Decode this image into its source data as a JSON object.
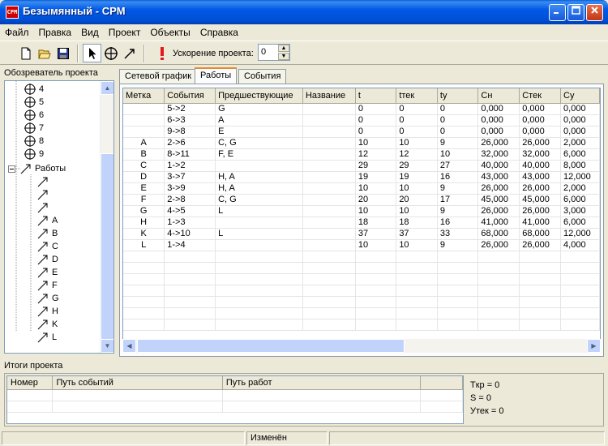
{
  "window": {
    "title": "Безымянный - CPM",
    "app_icon_text": "CPM"
  },
  "menu": [
    "Файл",
    "Правка",
    "Вид",
    "Проект",
    "Объекты",
    "Справка"
  ],
  "toolbar": {
    "buttons": [
      "new-file-icon",
      "open-folder-icon",
      "save-icon",
      "pointer-icon",
      "event-node-icon",
      "arrow-work-icon",
      "exclamation-icon"
    ],
    "acceleration_label": "Ускорение проекта:",
    "acceleration_value": "0"
  },
  "explorer": {
    "title": "Обозреватель проекта",
    "events": [
      "4",
      "5",
      "6",
      "7",
      "8",
      "9"
    ],
    "works_label": "Работы",
    "works": [
      "",
      "",
      "",
      "A",
      "B",
      "C",
      "D",
      "E",
      "F",
      "G",
      "H",
      "K",
      "L"
    ]
  },
  "tabs": [
    "Сетевой график",
    "Работы",
    "События"
  ],
  "active_tab": "Работы",
  "grid": {
    "columns": [
      "Метка",
      "События",
      "Предшествующие",
      "Название",
      "t",
      "tтек",
      "tу",
      "Сн",
      "Стек",
      "Су"
    ],
    "rows": [
      [
        "",
        "5->2",
        "G",
        "",
        "0",
        "0",
        "0",
        "0,000",
        "0,000",
        "0,000"
      ],
      [
        "",
        "6->3",
        "A",
        "",
        "0",
        "0",
        "0",
        "0,000",
        "0,000",
        "0,000"
      ],
      [
        "",
        "9->8",
        "E",
        "",
        "0",
        "0",
        "0",
        "0,000",
        "0,000",
        "0,000"
      ],
      [
        "A",
        "2->6",
        "C, G",
        "",
        "10",
        "10",
        "9",
        "26,000",
        "26,000",
        "2,000"
      ],
      [
        "B",
        "8->11",
        "F, E",
        "",
        "12",
        "12",
        "10",
        "32,000",
        "32,000",
        "6,000"
      ],
      [
        "C",
        "1->2",
        "",
        "",
        "29",
        "29",
        "27",
        "40,000",
        "40,000",
        "8,000"
      ],
      [
        "D",
        "3->7",
        "H, A",
        "",
        "19",
        "19",
        "16",
        "43,000",
        "43,000",
        "12,000"
      ],
      [
        "E",
        "3->9",
        "H, A",
        "",
        "10",
        "10",
        "9",
        "26,000",
        "26,000",
        "2,000"
      ],
      [
        "F",
        "2->8",
        "C, G",
        "",
        "20",
        "20",
        "17",
        "45,000",
        "45,000",
        "6,000"
      ],
      [
        "G",
        "4->5",
        "L",
        "",
        "10",
        "10",
        "9",
        "26,000",
        "26,000",
        "3,000"
      ],
      [
        "H",
        "1->3",
        "",
        "",
        "18",
        "18",
        "16",
        "41,000",
        "41,000",
        "6,000"
      ],
      [
        "K",
        "4->10",
        "L",
        "",
        "37",
        "37",
        "33",
        "68,000",
        "68,000",
        "12,000"
      ],
      [
        "L",
        "1->4",
        "",
        "",
        "10",
        "10",
        "9",
        "26,000",
        "26,000",
        "4,000"
      ]
    ]
  },
  "summary": {
    "title": "Итоги проекта",
    "columns": [
      "Номер",
      "Путь событий",
      "Путь работ"
    ],
    "metrics": [
      "Tкр = 0",
      "S = 0",
      "Утек = 0"
    ]
  },
  "status": {
    "text": "Изменён"
  }
}
